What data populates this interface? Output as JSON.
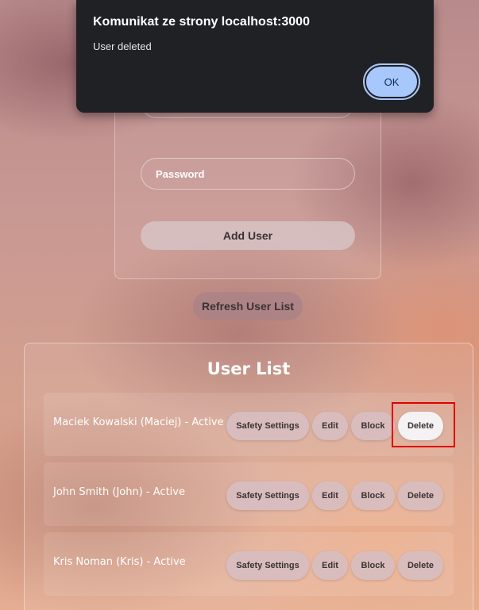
{
  "form": {
    "password_placeholder": "Password",
    "add_user_label": "Add User"
  },
  "refresh_label": "Refresh User List",
  "user_list": {
    "title": "User List",
    "users": [
      {
        "text": "Maciek Kowalski (Maciej) - Active"
      },
      {
        "text": "John Smith (John) - Active"
      },
      {
        "text": "Kris Noman (Kris) - Active"
      }
    ],
    "actions": {
      "safety": "Safety Settings",
      "edit": "Edit",
      "block": "Block",
      "delete": "Delete"
    }
  },
  "dialog": {
    "title": "Komunikat ze strony localhost:3000",
    "message": "User deleted",
    "ok_label": "OK"
  },
  "colors": {
    "highlight": "#e00000",
    "ok_button": "#a8c7fa",
    "dialog_bg": "#202124"
  }
}
